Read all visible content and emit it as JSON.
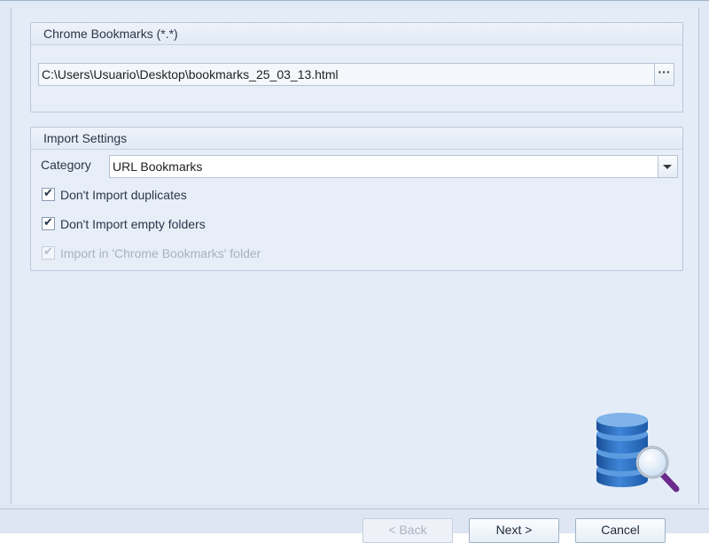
{
  "source_group": {
    "title": "Chrome Bookmarks (*.*)",
    "file_path": "C:\\Users\\Usuario\\Desktop\\bookmarks_25_03_13.html",
    "browse_label": "···"
  },
  "import_settings": {
    "title": "Import Settings",
    "category_label": "Category",
    "category_value": "URL Bookmarks",
    "options": [
      {
        "label": "Don't Import duplicates",
        "checked": true,
        "enabled": true
      },
      {
        "label": "Don't Import empty folders",
        "checked": true,
        "enabled": true
      },
      {
        "label": "Import in 'Chrome Bookmarks' folder",
        "checked": true,
        "enabled": false
      }
    ]
  },
  "footer": {
    "back_label": "< Back",
    "next_label": "Next >",
    "cancel_label": "Cancel"
  },
  "icons": {
    "illustration": "database-search-icon",
    "accent": "#2a6fc2"
  }
}
